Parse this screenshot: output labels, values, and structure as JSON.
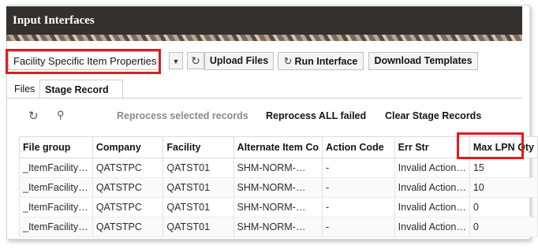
{
  "banner": {
    "title": "Input Interfaces"
  },
  "toolbar": {
    "selected_interface": "Facility Specific Item Properties",
    "upload_label": "Upload Files",
    "run_label": "Run Interface",
    "download_label": "Download Templates"
  },
  "tabs": [
    {
      "label": "Files",
      "active": false
    },
    {
      "label": "Stage Record",
      "active": true
    }
  ],
  "actions": {
    "reprocess_selected": "Reprocess selected records",
    "reprocess_all": "Reprocess ALL failed",
    "clear_stage": "Clear Stage Records"
  },
  "table": {
    "columns": [
      "File group",
      "Company",
      "Facility",
      "Alternate Item Co",
      "Action Code",
      "Err Str",
      "Max LPN Qty"
    ],
    "rows": [
      [
        "_ItemFacility…",
        "QATSTPC",
        "QATST01",
        "SHM-NORM-…",
        "-",
        "Invalid Action…",
        "15"
      ],
      [
        "_ItemFacility…",
        "QATSTPC",
        "QATST01",
        "SHM-NORM-…",
        "-",
        "Invalid Action…",
        "10"
      ],
      [
        "_ItemFacility…",
        "QATSTPC",
        "QATST01",
        "SHM-NORM-…",
        "-",
        "Invalid Action…",
        "0"
      ],
      [
        "_ItemFacility…",
        "QATSTPC",
        "QATST01",
        "SHM-NORM-…",
        "-",
        "Invalid Action…",
        "0"
      ]
    ]
  },
  "colors": {
    "highlight": "#e11b22",
    "banner": "#33302d"
  },
  "icons": {
    "refresh": "refresh-icon",
    "search": "search-icon",
    "dropdown": "chevron-down-icon"
  }
}
